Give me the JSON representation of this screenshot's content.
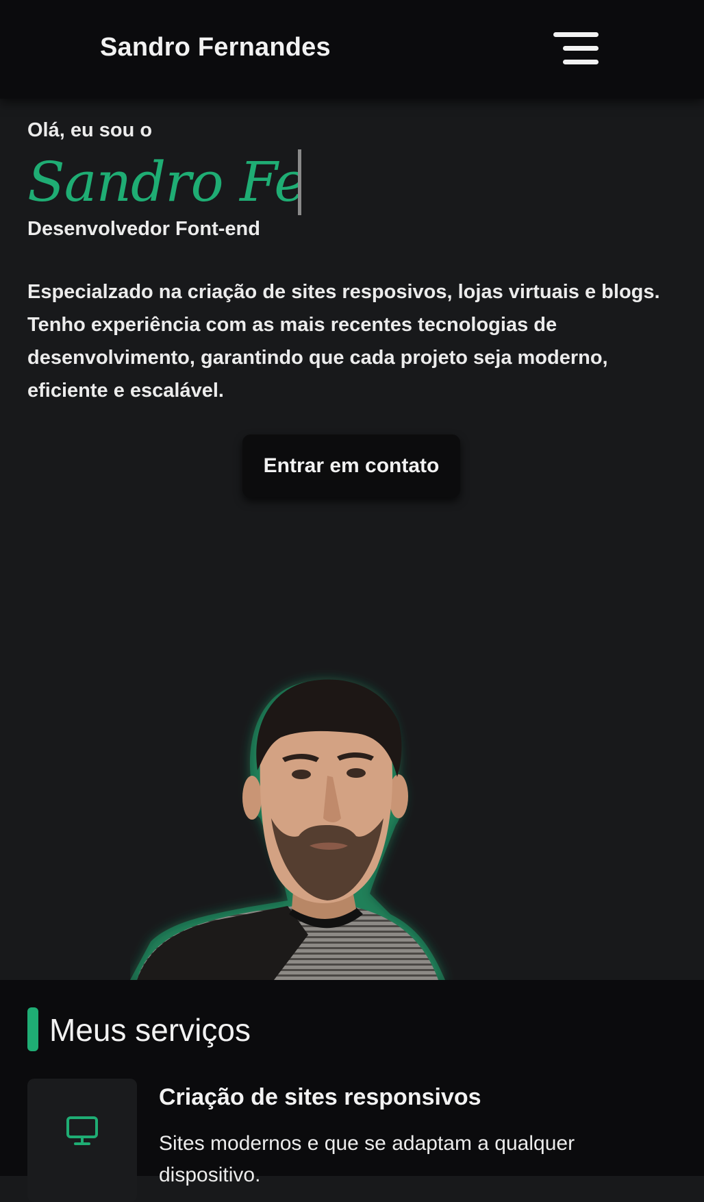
{
  "header": {
    "brand": "Sandro Fernandes",
    "menu_icon": "hamburger-menu-icon"
  },
  "hero": {
    "greeting": "Olá, eu sou o",
    "typed_name": "Sandro Fern",
    "role": "Desenvolvedor Font-end",
    "description": "Especialzado na criação de sites resposivos, lojas virtuais e blogs. Tenho experiência com as mais recentes tecnologias de desenvolvimento, garantindo que cada projeto seja moderno, eficiente e escalável.",
    "cta_label": "Entrar em contato"
  },
  "services": {
    "title": "Meus serviços",
    "items": [
      {
        "icon": "monitor-icon",
        "title": "Criação de sites responsivos",
        "description": "Sites modernos e que se adaptam a qualquer dispositivo."
      }
    ]
  },
  "colors": {
    "accent": "#1fad74",
    "background": "#18191b",
    "header_background": "#0b0b0d"
  }
}
